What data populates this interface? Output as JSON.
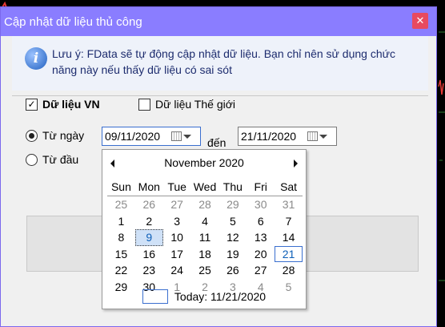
{
  "window": {
    "title": "Cập nhật dữ liệu thủ công",
    "close_glyph": "✕"
  },
  "note": {
    "icon": "info-icon",
    "text": "Lưu ý: FData sẽ tự động cập nhật dữ liệu. Bạn chỉ nên sử dụng chức năng này nếu thấy dữ liệu có sai sót"
  },
  "options": {
    "vn": {
      "label": "Dữ liệu VN",
      "checked": true
    },
    "world": {
      "label": "Dữ liệu Thế giới",
      "checked": false
    }
  },
  "range": {
    "from_label": "Từ ngày",
    "from_date": "09/11/2020",
    "to_label": "đến",
    "to_date": "21/11/2020",
    "from_start_label": "Từ đầu"
  },
  "calendar": {
    "month": "November 2020",
    "weekdays": [
      "Sun",
      "Mon",
      "Tue",
      "Wed",
      "Thu",
      "Fri",
      "Sat"
    ],
    "weeks": [
      [
        "25",
        "26",
        "27",
        "28",
        "29",
        "30",
        "31"
      ],
      [
        "1",
        "2",
        "3",
        "4",
        "5",
        "6",
        "7"
      ],
      [
        "8",
        "9",
        "10",
        "11",
        "12",
        "13",
        "14"
      ],
      [
        "15",
        "16",
        "17",
        "18",
        "19",
        "20",
        "21"
      ],
      [
        "22",
        "23",
        "24",
        "25",
        "26",
        "27",
        "28"
      ],
      [
        "29",
        "30",
        "1",
        "2",
        "3",
        "4",
        "5"
      ]
    ],
    "muted_first_row": true,
    "muted_last_from": 2,
    "selected_day": "9",
    "today_day": "21",
    "today_label": "Today: 11/21/2020"
  }
}
